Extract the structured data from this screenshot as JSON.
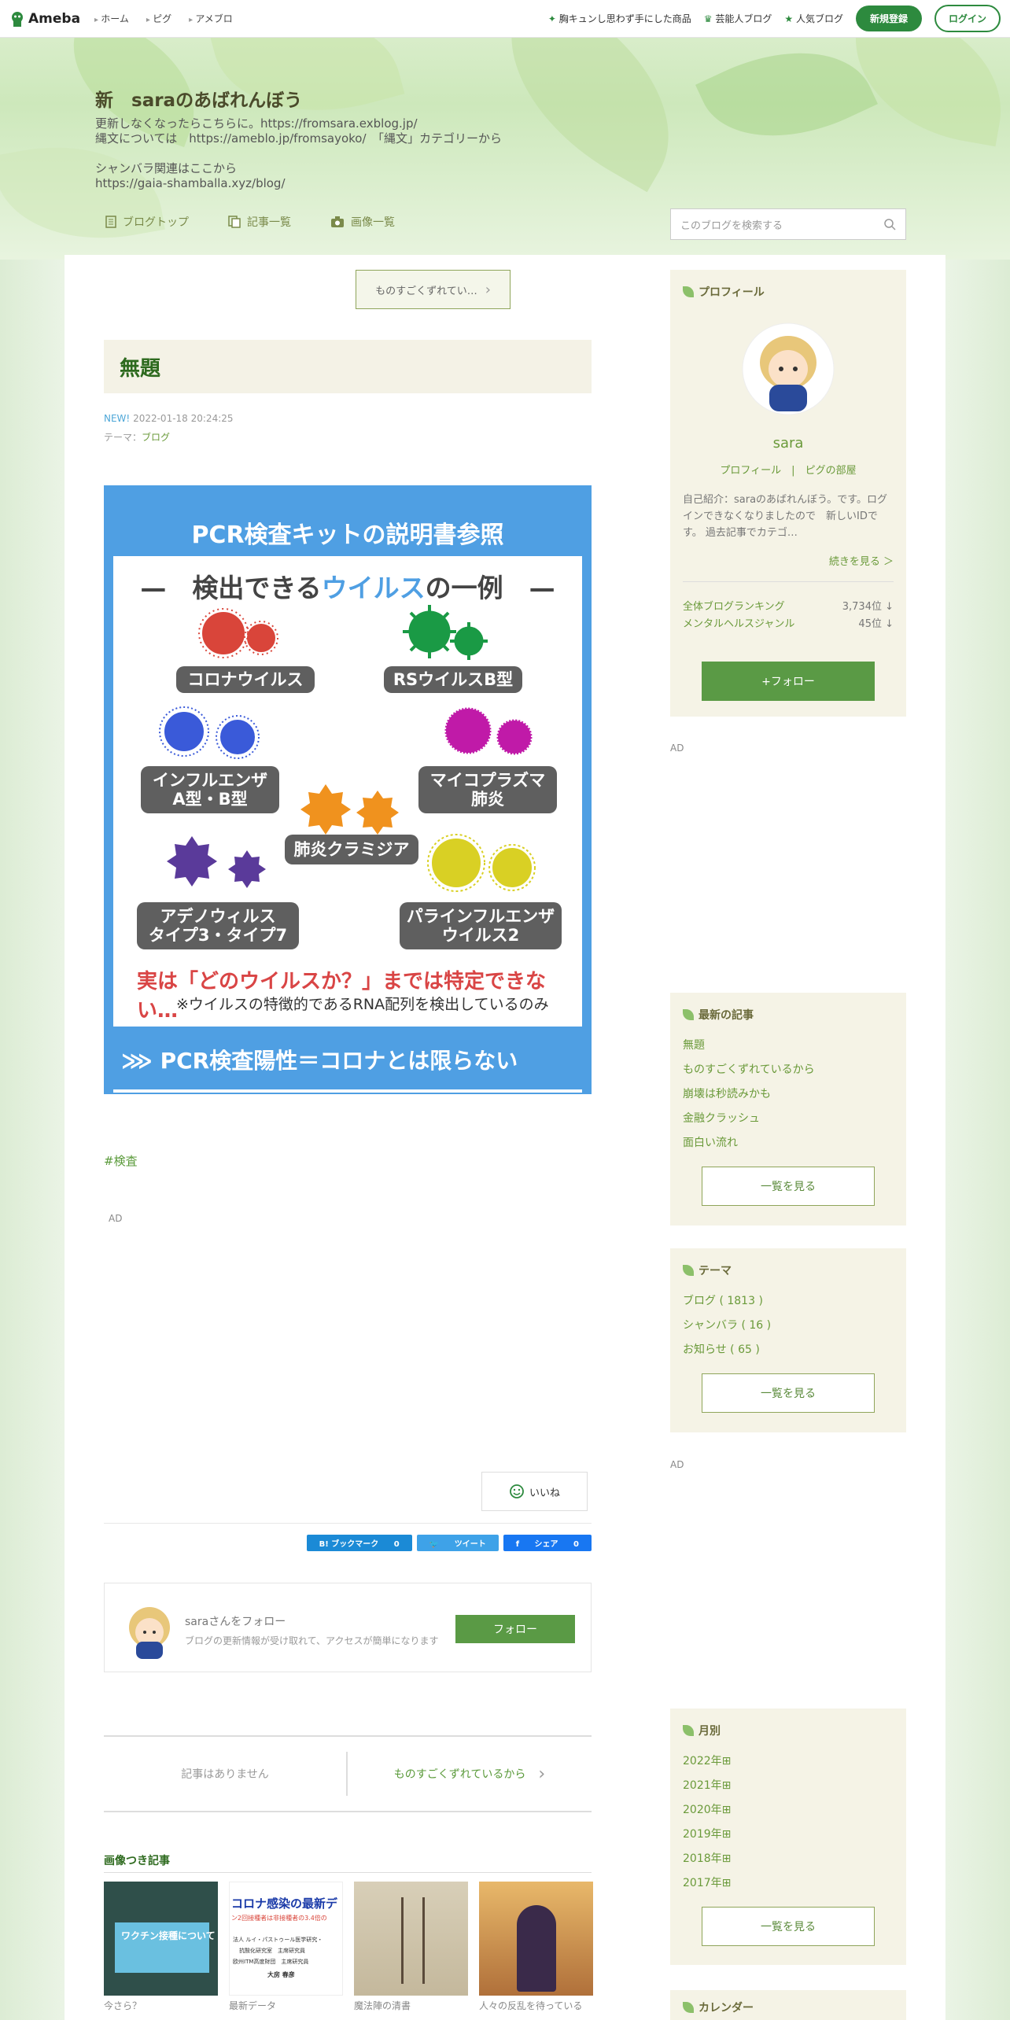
{
  "topbar": {
    "logo": "Ameba",
    "nav_left": [
      "ホーム",
      "ピグ",
      "アメブロ"
    ],
    "nav_right": [
      "胸キュンし思わず手にした商品",
      "芸能人ブログ",
      "人気ブログ"
    ],
    "register": "新規登録",
    "login": "ログイン"
  },
  "blog": {
    "title": "新　saraのあばれんぼう",
    "desc": [
      "更新しなくなったらこちらに。https://fromsara.exblog.jp/",
      "縄文については　https://ameblo.jp/fromsayoko/　「縄文」カテゴリーから",
      "",
      "シャンバラ関連はここから",
      "https://gaia-shamballa.xyz/blog/"
    ]
  },
  "tabs": [
    "ブログトップ",
    "記事一覧",
    "画像一覧"
  ],
  "search": {
    "placeholder": "このブログを検索する"
  },
  "entry": {
    "prev": "ものすごくずれてい…",
    "title": "無題",
    "new": "NEW!",
    "date": "2022-01-18 20:24:25",
    "theme_label": "テーマ：",
    "theme": "ブログ",
    "tag": "#検査",
    "ad": "AD",
    "like": "いいね"
  },
  "image": {
    "title": "PCR検査キットの説明書参照",
    "header_a": "検出できる",
    "header_b": "ウイルス",
    "header_c": "の一例",
    "labels": [
      "コロナウイルス",
      "RSウイルスB型",
      "インフルエンザ\nA型・B型",
      "マイコプラズマ\n肺炎",
      "肺炎クラミジア",
      "アデノウィルス\nタイプ3・タイプ7",
      "パラインフルエンザ\nウイルス2"
    ],
    "red": "実は「どのウイルスか？」までは特定できない…",
    "note": "※ウイルスの特徴的であるRNA配列を検出しているのみ",
    "bottom": "PCR検査陽性＝コロナとは限らない"
  },
  "share": {
    "hatena": "B! ブックマーク",
    "hatena_count": "0",
    "tweet": "ツイート",
    "fb": "シェア",
    "fb_count": "0"
  },
  "follow": {
    "name": "saraさんをフォロー",
    "sub": "ブログの更新情報が受け取れて、アクセスが簡単になります",
    "button": "フォロー"
  },
  "pager": {
    "prev": "記事はありません",
    "next": "ものすごくずれているから"
  },
  "image_articles": {
    "title": "画像つき記事",
    "items": [
      {
        "cap": "今さら？"
      },
      {
        "cap": "最新データ",
        "text1": "コロナ感染の最新デ",
        "text2": "ン2回接種者は非接種者の3.4倍の",
        "text3": "法人 ルイ・パストゥール医学研究・",
        "text4": "抗酸化研究室　主席研究員",
        "text5": "欧州ITM高度財団　主席研究員",
        "text6": "大房 春彦"
      },
      {
        "cap": "魔法陣の清書"
      },
      {
        "cap": "人々の反乱を待っている"
      }
    ],
    "thumb1": "ワクチン接種について"
  },
  "profile": {
    "heading": "プロフィール",
    "name": "sara",
    "link1": "プロフィール",
    "link2": "ピグの部屋",
    "intro": "自己紹介：saraのあばれんぼう。です。ログインできなくなりましたので　新しいIDです。 過去記事でカテゴ…",
    "more": "続きを見る ＞",
    "rank1_label": "全体ブログランキング",
    "rank1": "3,734位 ↓",
    "rank2_label": "メンタルヘルスジャンル",
    "rank2": "45位 ↓",
    "follow": "+フォロー"
  },
  "ads": [
    "AD",
    "AD"
  ],
  "recent": {
    "heading": "最新の記事",
    "items": [
      "無題",
      "ものすごくずれているから",
      "崩壊は秒読みかも",
      "金融クラッシュ",
      "面白い流れ"
    ],
    "more": "一覧を見る"
  },
  "theme": {
    "heading": "テーマ",
    "items": [
      "ブログ ( 1813 )",
      "シャンバラ ( 16 )",
      "お知らせ ( 65 )"
    ],
    "more": "一覧を見る"
  },
  "monthly": {
    "heading": "月別",
    "items": [
      "2022年",
      "2021年",
      "2020年",
      "2019年",
      "2018年",
      "2017年"
    ],
    "more": "一覧を見る"
  },
  "calendar": {
    "heading": "カレンダー"
  },
  "colors": {
    "accent": "#2d8a3e",
    "image_blue": "#4f9fe3",
    "sidebar_bg": "#f5f3e6"
  }
}
